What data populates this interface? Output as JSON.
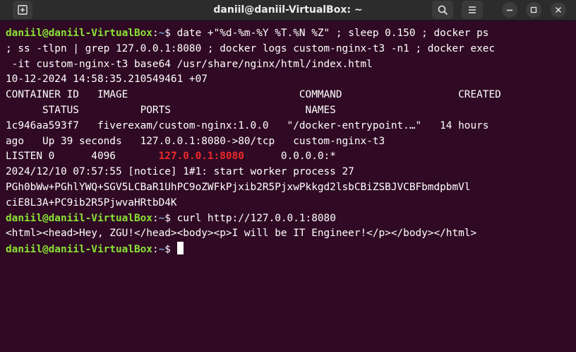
{
  "window": {
    "title": "daniil@daniil-VirtualBox: ~"
  },
  "icons": [
    "new-tab-icon",
    "search-icon",
    "hamburger-menu-icon",
    "minimize-icon",
    "maximize-icon",
    "close-icon"
  ],
  "colors": {
    "background": "#300a24",
    "prompt_user": "#8ae234",
    "prompt_path": "#729fcf",
    "grep_match": "#ef2929",
    "text": "#ffffff"
  },
  "prompt": {
    "user_host": "daniil@daniil-VirtualBox",
    "sep": ":",
    "path": "~",
    "sigil": "$ "
  },
  "cmd1": {
    "line1": "date +\"%d-%m-%Y %T.%N %Z\" ; sleep 0.150 ; docker ps",
    "line2": "; ss -tlpn | grep 127.0.0.1:8080 ; docker logs custom-nginx-t3 -n1 ; docker exec",
    "line3": " -it custom-nginx-t3 base64 /usr/share/nginx/html/index.html"
  },
  "date_output": "10-12-2024 14:58:35.210549461 +07",
  "docker_ps": {
    "header_line1": "CONTAINER ID   IMAGE                            COMMAND                   CREATED",
    "header_line2": "      STATUS          PORTS                      NAMES",
    "row_line1": "1c946aa593f7   fiverexam/custom-nginx:1.0.0   \"/docker-entrypoint.…\"   14 hours",
    "row_line2": "ago   Up 39 seconds   127.0.0.1:8080->80/tcp   custom-nginx-t3"
  },
  "ss_output": {
    "prefix": "LISTEN 0      4096       ",
    "match": "127.0.0.1:8080",
    "suffix": "      0.0.0.0:*"
  },
  "docker_log": "2024/12/10 07:57:55 [notice] 1#1: start worker process 27",
  "base64_output": {
    "line1": "PGh0bWw+PGhlYWQ+SGV5LCBaR1UhPC9oZWFkPjxib2R5PjxwPkkgd2lsbCBiZSBJVCBFbmdpbmVl",
    "line2": "ciE8L3A+PC9ib2R5PjwvaHRtbD4K"
  },
  "cmd2": "curl http://127.0.0.1:8080",
  "curl_output": "<html><head>Hey, ZGU!</head><body><p>I will be IT Engineer!</p></body></html>"
}
